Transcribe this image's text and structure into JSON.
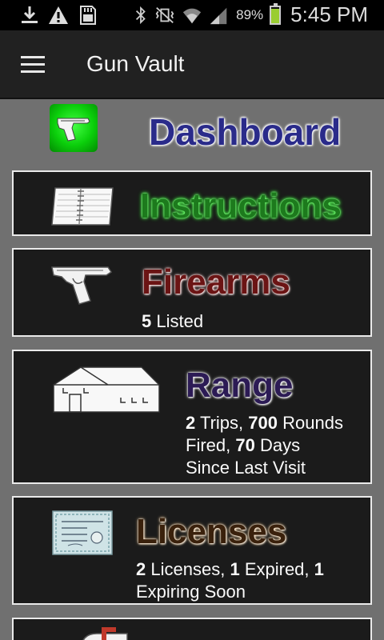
{
  "status_bar": {
    "battery_percent": "89%",
    "battery_level": 0.89,
    "time": "5:45 PM",
    "icons": [
      "download-icon",
      "warning-icon",
      "sd-card-icon",
      "bluetooth-icon",
      "vibrate-icon",
      "wifi-icon",
      "signal-icon",
      "battery-icon"
    ]
  },
  "app_bar": {
    "title": "Gun Vault",
    "menu_icon": "hamburger-menu-icon"
  },
  "dashboard": {
    "title": "Dashboard",
    "icon": "pistol-on-green-icon"
  },
  "cards": {
    "instructions": {
      "title": "Instructions",
      "icon": "notebook-icon",
      "color": "#1d7a1d"
    },
    "firearms": {
      "title": "Firearms",
      "icon": "pistol-icon",
      "color": "#6b1414",
      "count": "5",
      "count_label": "Listed"
    },
    "range": {
      "title": "Range",
      "icon": "building-icon",
      "color": "#2c1b55",
      "trips": "2",
      "trips_label": "Trips,",
      "rounds": "700",
      "rounds_label": "Rounds",
      "fired_label": "Fired,",
      "days": "70",
      "days_label": "Days",
      "since_label": "Since Last Visit"
    },
    "licenses": {
      "title": "Licenses",
      "icon": "certificate-icon",
      "color": "#3a210c",
      "licenses": "2",
      "licenses_label": "Licenses,",
      "expired": "1",
      "expired_label": "Expired,",
      "expiring": "1",
      "expiring_label": "Expiring Soon"
    },
    "next": {
      "icon": "mailbox-icon"
    }
  }
}
